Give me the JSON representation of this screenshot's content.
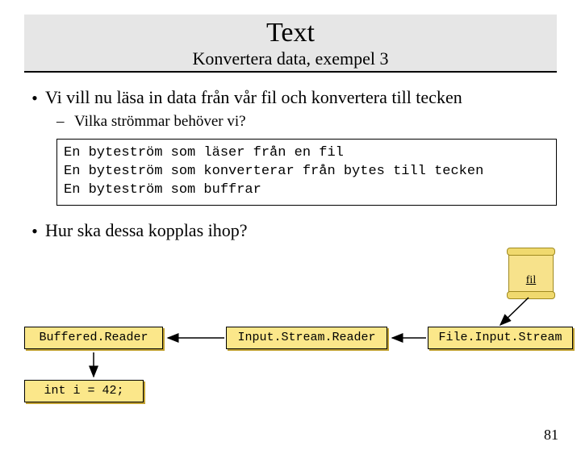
{
  "title": "Text",
  "subtitle": "Konvertera data, exempel 3",
  "bullets": {
    "b1": "Vi vill nu läsa in data från vår fil och konvertera till tecken",
    "s1": "Vilka strömmar behöver vi?",
    "b2": "Hur ska dessa kopplas ihop?"
  },
  "code_lines": "En byteström som läser från en fil\nEn byteström som konverterar från bytes till tecken\nEn byteström som buffrar",
  "file_label": "fil",
  "nodes": {
    "buffered": "Buffered.Reader",
    "isr": "Input.Stream.Reader",
    "fis": "File.Input.Stream",
    "intline": "int i = 42;"
  },
  "page": "81"
}
